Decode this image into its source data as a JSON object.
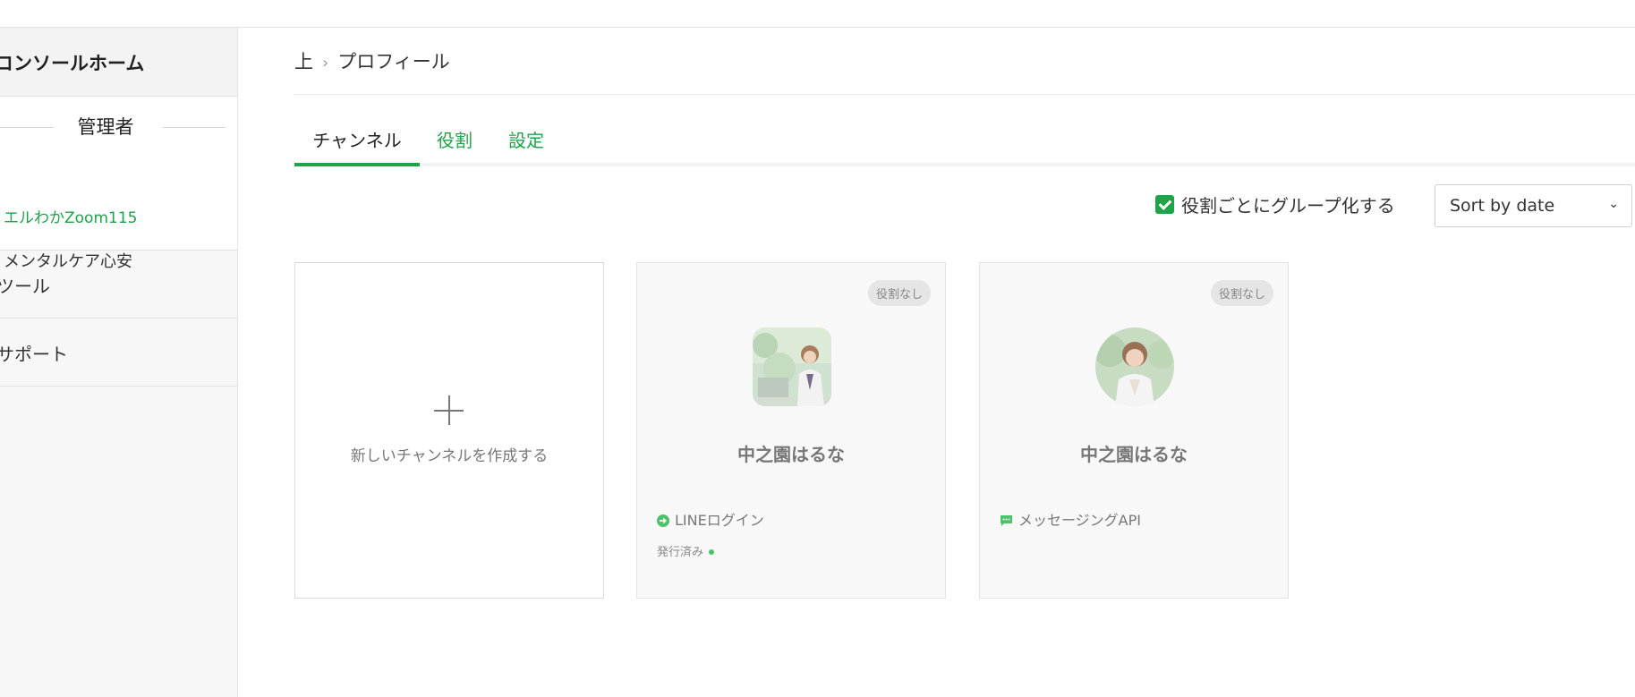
{
  "sidebar": {
    "home_label": "コンソールホーム",
    "admin_title": "管理者",
    "channels": [
      {
        "label": "エルわかZoom115"
      },
      {
        "label": "メンタルケア心安"
      }
    ],
    "items": [
      {
        "label": "ツール"
      },
      {
        "label": "サポート"
      }
    ]
  },
  "breadcrumb": {
    "root": "上",
    "current": "プロフィール"
  },
  "tabs": [
    {
      "label": "チャンネル"
    },
    {
      "label": "役割"
    },
    {
      "label": "設定"
    }
  ],
  "toolbar": {
    "group_checkbox_label": "役割ごとにグループ化する",
    "group_checked": true,
    "sort_value": "Sort by date"
  },
  "new_channel": {
    "label": "新しいチャンネルを作成する"
  },
  "cards": [
    {
      "badge": "役割なし",
      "name": "中之園はるな",
      "feature": "LINEログイン",
      "feature_icon": "login-arrow-icon",
      "status": "発行済み"
    },
    {
      "badge": "役割なし",
      "name": "中之園はるな",
      "feature": "メッセージングAPI",
      "feature_icon": "chat-bubble-icon"
    }
  ],
  "colors": {
    "accent": "#1fa34a",
    "card_bg": "#f8f8f8",
    "sidebar_bg": "#f7f7f7"
  }
}
